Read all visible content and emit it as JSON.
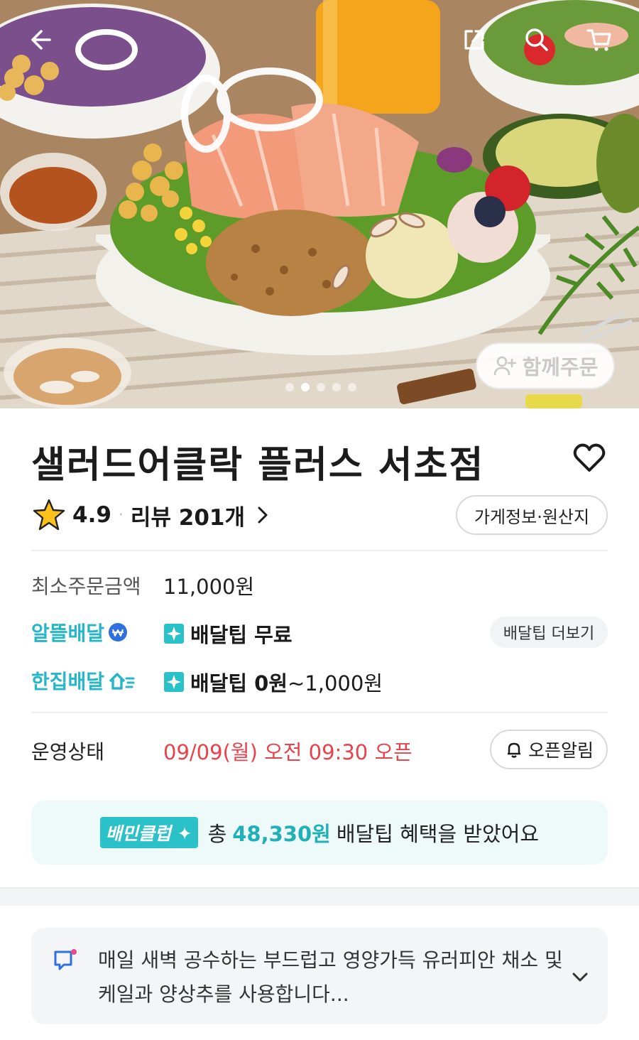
{
  "hero": {
    "together_order_label": "함께주문",
    "carousel_total": 5,
    "carousel_active": 2
  },
  "store": {
    "name": "샐러드어클락 플러스 서초점",
    "rating": "4.9",
    "review_label": "리뷰 201개",
    "info_button": "가게정보·원산지"
  },
  "details": {
    "min_order_label": "최소주문금액",
    "min_order_value": "11,000원",
    "altteul_label": "알뜰배달",
    "altteul_tip": "배달팁 무료",
    "more_tip_button": "배달팁 더보기",
    "hanjip_label": "한집배달",
    "hanjip_tip_bold": "배달팁 0원",
    "hanjip_tip_rest": "~1,000원",
    "status_label": "운영상태",
    "status_value": "09/09(월) 오전 09:30 오픈",
    "open_alarm_button": "오픈알림"
  },
  "club": {
    "badge": "배민클럽",
    "prefix": "총",
    "amount": "48,330원",
    "suffix": "배달팁 혜택을 받았어요"
  },
  "notice": {
    "text": "매일 새벽 공수하는 부드럽고 영양가득 유러피안 채소 및 케일과 양상추를 사용합니다..."
  },
  "icons": {
    "back": "arrow-left-icon",
    "share": "share-icon",
    "search": "search-icon",
    "cart": "cart-icon",
    "favorite": "heart-icon",
    "rating": "star-icon",
    "alarm": "bell-icon",
    "notice": "message-icon",
    "expand": "chevron-down-icon"
  },
  "colors": {
    "accent_cyan": "#25b6c8",
    "status_red": "#e8424c",
    "club_bg": "#eefafa"
  }
}
